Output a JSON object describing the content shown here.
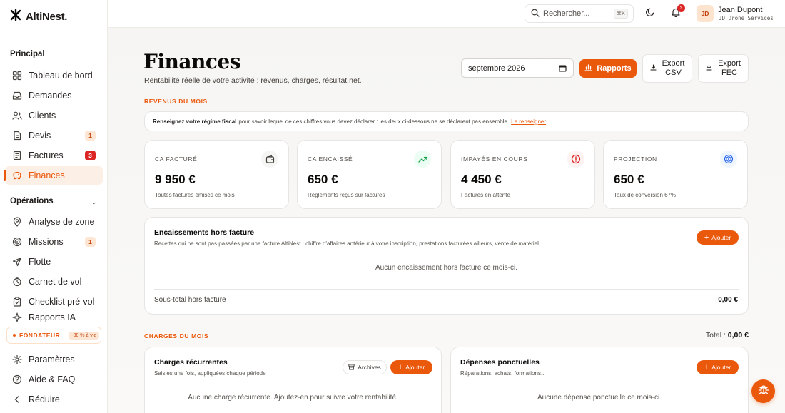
{
  "app": {
    "logo_text": "AltiNest."
  },
  "sidebar": {
    "section_principal": "Principal",
    "principal_items": [
      {
        "label": "Tableau de bord",
        "icon": "dashboard-icon"
      },
      {
        "label": "Demandes",
        "icon": "inbox-icon"
      },
      {
        "label": "Clients",
        "icon": "users-icon"
      },
      {
        "label": "Devis",
        "icon": "document-icon",
        "badge": "1"
      },
      {
        "label": "Factures",
        "icon": "invoice-icon",
        "badge": "3"
      },
      {
        "label": "Finances",
        "icon": "finance-icon",
        "active": true
      }
    ],
    "section_operations": "Opérations",
    "operations_items": [
      {
        "label": "Analyse de zone",
        "icon": "map-pin-icon"
      },
      {
        "label": "Missions",
        "icon": "target-icon",
        "badge": "1"
      },
      {
        "label": "Flotte",
        "icon": "plane-icon"
      },
      {
        "label": "Carnet de vol",
        "icon": "clock-icon"
      },
      {
        "label": "Checklist pré-vol",
        "icon": "clipboard-icon"
      },
      {
        "label": "Rapports IA",
        "icon": "sparkle-icon"
      }
    ],
    "founder_label": "FONDATEUR",
    "founder_pill": "-30 % à vie",
    "bottom_items": [
      {
        "label": "Paramètres",
        "icon": "gear-icon"
      },
      {
        "label": "Aide & FAQ",
        "icon": "help-icon"
      },
      {
        "label": "Réduire",
        "icon": "chevron-left-icon"
      }
    ]
  },
  "topbar": {
    "search_placeholder": "Rechercher...",
    "search_shortcut": "⌘K",
    "notification_count": "3",
    "avatar_initials": "JD",
    "user_name": "Jean Dupont",
    "user_company": "JD Drone Services"
  },
  "page": {
    "title": "Finances",
    "subtitle": "Rentabilité réelle de votre activité : revenus, charges, résultat net.",
    "month_value": "septembre 2026",
    "btn_reports": "Rapports",
    "btn_export_csv_1": "Export",
    "btn_export_csv_2": "CSV",
    "btn_export_fec_1": "Export",
    "btn_export_fec_2": "FEC"
  },
  "revenus": {
    "section_label": "REVENUS DU MOIS",
    "info_bold": "Renseignez votre régime fiscal",
    "info_text": "pour savoir lequel de ces chiffres vous devez déclarer : les deux ci-dessous ne se déclarent pas ensemble.",
    "info_link": "Le renseigner",
    "kpis": [
      {
        "label": "CA FACTURÉ",
        "value": "9 950 €",
        "note": "Toutes factures émises ce mois",
        "icon": "wallet-icon"
      },
      {
        "label": "CA ENCAISSÉ",
        "value": "650 €",
        "note": "Règlements reçus sur factures",
        "icon": "trend-up-icon"
      },
      {
        "label": "IMPAYÉS EN COURS",
        "value": "4 450 €",
        "note": "Factures en attente",
        "icon": "alert-circle-icon"
      },
      {
        "label": "PROJECTION",
        "value": "650 €",
        "note": "Taux de conversion 67%",
        "icon": "target-icon"
      }
    ]
  },
  "hors_facture": {
    "title": "Encaissements hors facture",
    "subtitle": "Recettes qui ne sont pas passées par une facture AltiNest : chiffre d'affaires antérieur à votre inscription, prestations facturées ailleurs, vente de matériel.",
    "add_label": "Ajouter",
    "empty": "Aucun encaissement hors facture ce mois-ci.",
    "subtotal_label": "Sous-total hors facture",
    "subtotal_value": "0,00 €"
  },
  "charges": {
    "section_label": "CHARGES DU MOIS",
    "total_label": "Total :",
    "total_value": "0,00 €",
    "recurring": {
      "title": "Charges récurrentes",
      "subtitle": "Saisies une fois, appliquées chaque période",
      "archive_label": "Archives",
      "add_label": "Ajouter",
      "empty": "Aucune charge récurrente. Ajoutez-en pour suivre votre rentabilité."
    },
    "oneoff": {
      "title": "Dépenses ponctuelles",
      "subtitle": "Réparations, achats, formations...",
      "add_label": "Ajouter",
      "empty": "Aucune dépense ponctuelle ce mois-ci."
    }
  },
  "colors": {
    "accent": "#ea580c",
    "danger": "#dc2626",
    "success": "#16a34a",
    "info": "#2563eb"
  }
}
